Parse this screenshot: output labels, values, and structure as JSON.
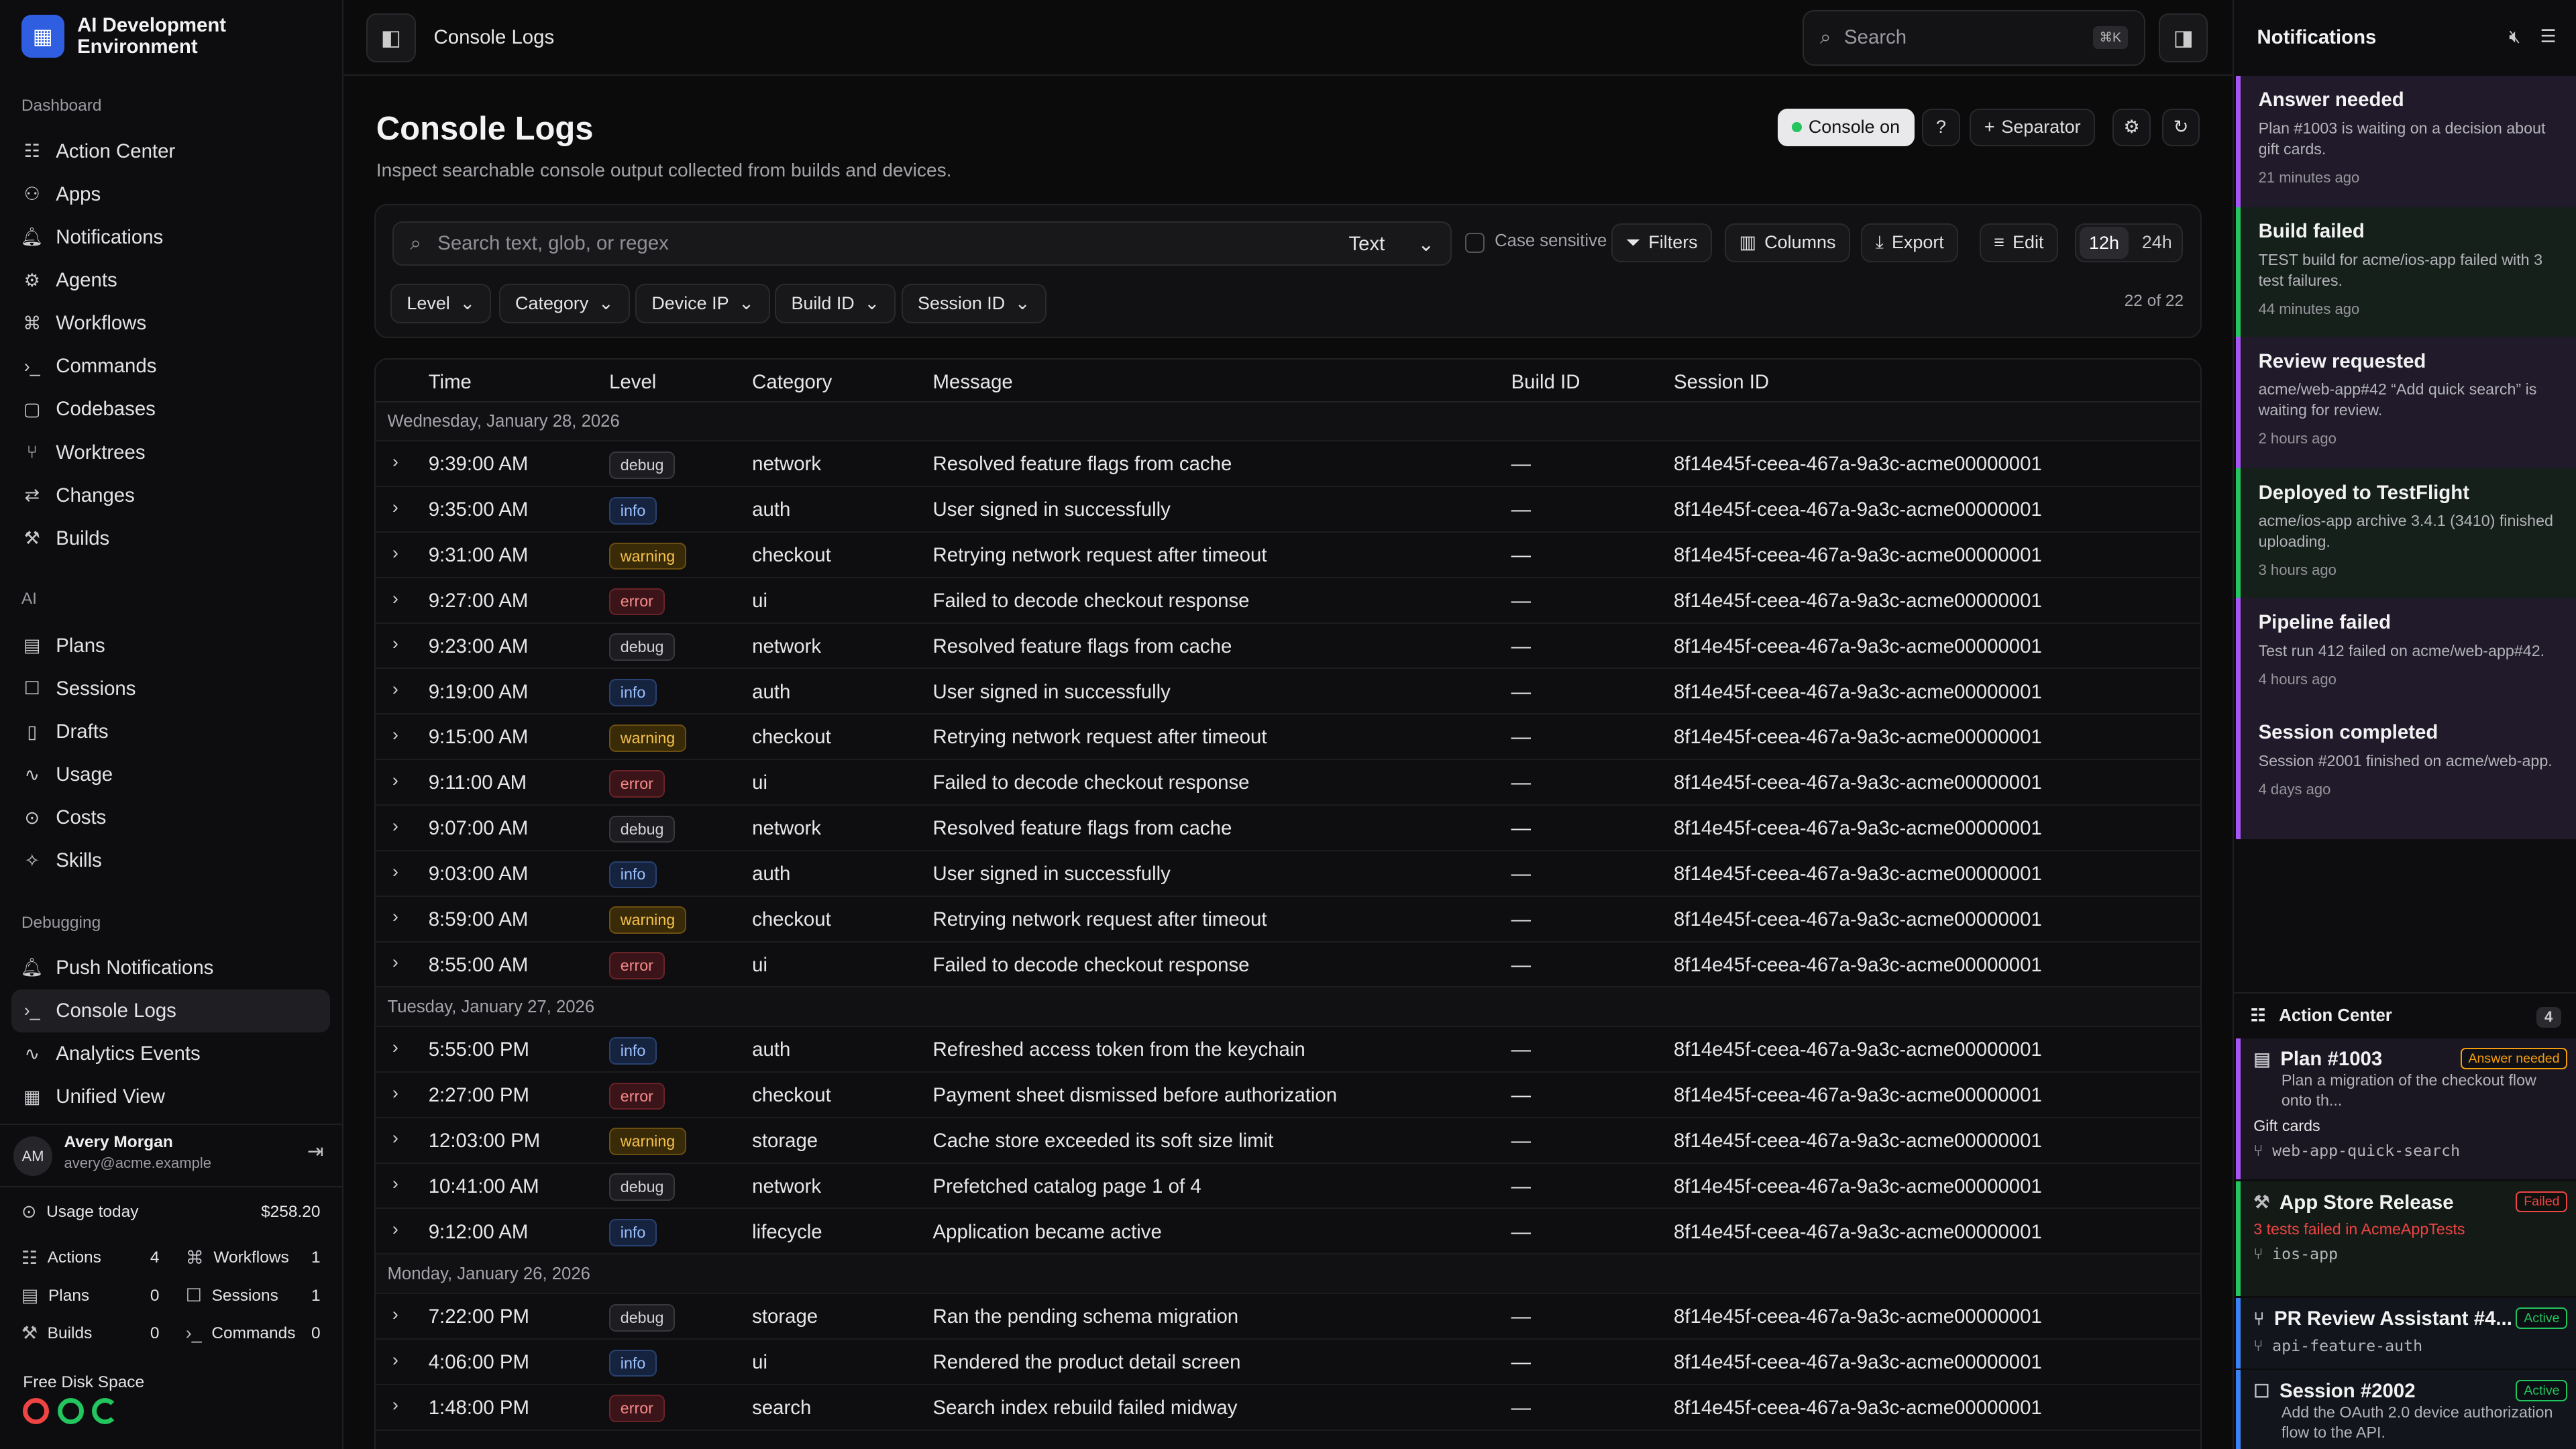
{
  "app": {
    "name": "AI Development Environment"
  },
  "sidebar": {
    "sections": [
      {
        "label": "Dashboard",
        "items": [
          {
            "label": "Action Center",
            "icon": "list-icon"
          },
          {
            "label": "Apps",
            "icon": "apps-icon"
          },
          {
            "label": "Notifications",
            "icon": "bell-icon"
          },
          {
            "label": "Agents",
            "icon": "agent-icon"
          },
          {
            "label": "Workflows",
            "icon": "workflow-icon"
          },
          {
            "label": "Commands",
            "icon": "terminal-icon"
          },
          {
            "label": "Codebases",
            "icon": "folder-icon"
          },
          {
            "label": "Worktrees",
            "icon": "branch-icon"
          },
          {
            "label": "Changes",
            "icon": "diff-icon"
          },
          {
            "label": "Builds",
            "icon": "hammer-icon"
          }
        ]
      },
      {
        "label": "AI",
        "items": [
          {
            "label": "Plans",
            "icon": "clipboard-icon"
          },
          {
            "label": "Sessions",
            "icon": "chat-icon"
          },
          {
            "label": "Drafts",
            "icon": "document-icon"
          },
          {
            "label": "Usage",
            "icon": "chart-icon"
          },
          {
            "label": "Costs",
            "icon": "dollar-icon"
          },
          {
            "label": "Skills",
            "icon": "sparkle-icon"
          }
        ]
      },
      {
        "label": "Debugging",
        "items": [
          {
            "label": "Push Notifications",
            "icon": "bell-icon"
          },
          {
            "label": "Console Logs",
            "icon": "terminal-icon",
            "active": true
          },
          {
            "label": "Analytics Events",
            "icon": "chart-icon"
          },
          {
            "label": "Unified View",
            "icon": "layout-icon"
          }
        ]
      }
    ],
    "user": {
      "initials": "AM",
      "name": "Avery Morgan",
      "email": "avery@acme.example"
    },
    "usage": {
      "label": "Usage today",
      "value": "$258.20"
    },
    "stats": [
      {
        "label": "Actions",
        "value": "4"
      },
      {
        "label": "Workflows",
        "value": "1"
      },
      {
        "label": "Plans",
        "value": "0"
      },
      {
        "label": "Sessions",
        "value": "1"
      },
      {
        "label": "Builds",
        "value": "0"
      },
      {
        "label": "Commands",
        "value": "0"
      }
    ],
    "disk": {
      "label": "Free Disk Space",
      "colors": [
        "#ef4444",
        "#22c55e",
        "#22c55e"
      ]
    }
  },
  "topbar": {
    "title": "Console Logs",
    "search_placeholder": "Search",
    "search_kbd": "⌘K"
  },
  "page": {
    "title": "Console Logs",
    "subtitle": "Inspect searchable console output collected from builds and devices.",
    "console_on": "Console on",
    "separator": "Separator"
  },
  "toolbar": {
    "search_placeholder": "Search text, glob, or regex",
    "mode": "Text",
    "case_label": "Case sensitive",
    "filters": "Filters",
    "columns": "Columns",
    "export": "Export",
    "edit": "Edit",
    "range_12h": "12h",
    "range_24h": "24h",
    "dropdowns": [
      "Level",
      "Category",
      "Device IP",
      "Build ID",
      "Session ID"
    ],
    "count": "22 of 22"
  },
  "table": {
    "headers": {
      "time": "Time",
      "level": "Level",
      "category": "Category",
      "message": "Message",
      "build": "Build ID",
      "session": "Session ID"
    },
    "groups": [
      {
        "date": "Wednesday, January 28, 2026",
        "rows": [
          {
            "time": "9:39:00 AM",
            "level": "debug",
            "category": "network",
            "message": "Resolved feature flags from cache",
            "build": "—",
            "session": "8f14e45f-ceea-467a-9a3c-acme00000001"
          },
          {
            "time": "9:35:00 AM",
            "level": "info",
            "category": "auth",
            "message": "User signed in successfully",
            "build": "—",
            "session": "8f14e45f-ceea-467a-9a3c-acme00000001"
          },
          {
            "time": "9:31:00 AM",
            "level": "warning",
            "category": "checkout",
            "message": "Retrying network request after timeout",
            "build": "—",
            "session": "8f14e45f-ceea-467a-9a3c-acme00000001"
          },
          {
            "time": "9:27:00 AM",
            "level": "error",
            "category": "ui",
            "message": "Failed to decode checkout response",
            "build": "—",
            "session": "8f14e45f-ceea-467a-9a3c-acme00000001"
          },
          {
            "time": "9:23:00 AM",
            "level": "debug",
            "category": "network",
            "message": "Resolved feature flags from cache",
            "build": "—",
            "session": "8f14e45f-ceea-467a-9a3c-acme00000001"
          },
          {
            "time": "9:19:00 AM",
            "level": "info",
            "category": "auth",
            "message": "User signed in successfully",
            "build": "—",
            "session": "8f14e45f-ceea-467a-9a3c-acme00000001"
          },
          {
            "time": "9:15:00 AM",
            "level": "warning",
            "category": "checkout",
            "message": "Retrying network request after timeout",
            "build": "—",
            "session": "8f14e45f-ceea-467a-9a3c-acme00000001"
          },
          {
            "time": "9:11:00 AM",
            "level": "error",
            "category": "ui",
            "message": "Failed to decode checkout response",
            "build": "—",
            "session": "8f14e45f-ceea-467a-9a3c-acme00000001"
          },
          {
            "time": "9:07:00 AM",
            "level": "debug",
            "category": "network",
            "message": "Resolved feature flags from cache",
            "build": "—",
            "session": "8f14e45f-ceea-467a-9a3c-acme00000001"
          },
          {
            "time": "9:03:00 AM",
            "level": "info",
            "category": "auth",
            "message": "User signed in successfully",
            "build": "—",
            "session": "8f14e45f-ceea-467a-9a3c-acme00000001"
          },
          {
            "time": "8:59:00 AM",
            "level": "warning",
            "category": "checkout",
            "message": "Retrying network request after timeout",
            "build": "—",
            "session": "8f14e45f-ceea-467a-9a3c-acme00000001"
          },
          {
            "time": "8:55:00 AM",
            "level": "error",
            "category": "ui",
            "message": "Failed to decode checkout response",
            "build": "—",
            "session": "8f14e45f-ceea-467a-9a3c-acme00000001"
          }
        ]
      },
      {
        "date": "Tuesday, January 27, 2026",
        "rows": [
          {
            "time": "5:55:00 PM",
            "level": "info",
            "category": "auth",
            "message": "Refreshed access token from the keychain",
            "build": "—",
            "session": "8f14e45f-ceea-467a-9a3c-acme00000001"
          },
          {
            "time": "2:27:00 PM",
            "level": "error",
            "category": "checkout",
            "message": "Payment sheet dismissed before authorization",
            "build": "—",
            "session": "8f14e45f-ceea-467a-9a3c-acme00000001"
          },
          {
            "time": "12:03:00 PM",
            "level": "warning",
            "category": "storage",
            "message": "Cache store exceeded its soft size limit",
            "build": "—",
            "session": "8f14e45f-ceea-467a-9a3c-acme00000001"
          },
          {
            "time": "10:41:00 AM",
            "level": "debug",
            "category": "network",
            "message": "Prefetched catalog page 1 of 4",
            "build": "—",
            "session": "8f14e45f-ceea-467a-9a3c-acme00000001"
          },
          {
            "time": "9:12:00 AM",
            "level": "info",
            "category": "lifecycle",
            "message": "Application became active",
            "build": "—",
            "session": "8f14e45f-ceea-467a-9a3c-acme00000001"
          }
        ]
      },
      {
        "date": "Monday, January 26, 2026",
        "rows": [
          {
            "time": "7:22:00 PM",
            "level": "debug",
            "category": "storage",
            "message": "Ran the pending schema migration",
            "build": "—",
            "session": "8f14e45f-ceea-467a-9a3c-acme00000001"
          },
          {
            "time": "4:06:00 PM",
            "level": "info",
            "category": "ui",
            "message": "Rendered the product detail screen",
            "build": "—",
            "session": "8f14e45f-ceea-467a-9a3c-acme00000001"
          },
          {
            "time": "1:48:00 PM",
            "level": "error",
            "category": "search",
            "message": "Search index rebuild failed midway",
            "build": "—",
            "session": "8f14e45f-ceea-467a-9a3c-acme00000001"
          }
        ]
      }
    ]
  },
  "notifications": {
    "title": "Notifications",
    "items": [
      {
        "title": "Answer needed",
        "body": "Plan #1003 is waiting on a decision about gift cards.",
        "time": "21 minutes ago",
        "color": "#a855f7",
        "bg": "#201a2a"
      },
      {
        "title": "Build failed",
        "body": "TEST build for acme/ios-app failed with 3 test failures.",
        "time": "44 minutes ago",
        "color": "#22c55e",
        "bg": "#15201a"
      },
      {
        "title": "Review requested",
        "body": "acme/web-app#42 “Add quick search” is waiting for review.",
        "time": "2 hours ago",
        "color": "#a855f7",
        "bg": "#201a2a"
      },
      {
        "title": "Deployed to TestFlight",
        "body": "acme/ios-app archive 3.4.1 (3410) finished uploading.",
        "time": "3 hours ago",
        "color": "#22c55e",
        "bg": "#15201a"
      },
      {
        "title": "Pipeline failed",
        "body": "Test run 412 failed on acme/web-app#42.",
        "time": "4 hours ago",
        "color": "#a855f7",
        "bg": "#201a2a"
      },
      {
        "title": "Session completed",
        "body": "Session #2001 finished on acme/web-app.",
        "time": "4 days ago",
        "color": "#a855f7",
        "bg": "#201a2a"
      }
    ]
  },
  "action_center": {
    "title": "Action Center",
    "count": "4",
    "items": [
      {
        "title": "Plan #1003",
        "tag": "Answer needed",
        "desc": "Plan a migration of the checkout flow onto th...",
        "sub": "Gift cards",
        "branch": "web-app-quick-search",
        "color": "#a855f7",
        "tag_color": "#f59e0b"
      },
      {
        "title": "App Store Release",
        "tag": "Failed",
        "error": "3 tests failed in AcmeAppTests",
        "branch": "ios-app",
        "color": "#22c55e",
        "tag_color": "#ef4444"
      },
      {
        "title": "PR Review Assistant #4...",
        "tag": "Active",
        "branch": "api-feature-auth",
        "color": "#3b82f6",
        "tag_color": "#22c55e"
      },
      {
        "title": "Session #2002",
        "tag": "Active",
        "desc": "Add the OAuth 2.0 device authorization flow to the API.",
        "color": "#3b82f6",
        "tag_color": "#22c55e"
      }
    ]
  }
}
